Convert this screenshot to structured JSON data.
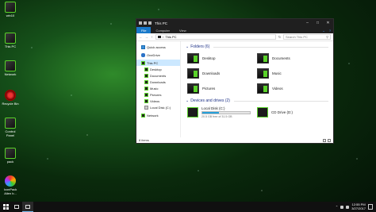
{
  "desktop": {
    "icons": [
      {
        "label": "win10",
        "icon": "win10-icon"
      },
      {
        "label": "This PC",
        "icon": "this-pc-icon"
      },
      {
        "label": "Network",
        "icon": "network-icon"
      },
      {
        "label": "Recycle Bin",
        "icon": "recycle-bin-icon"
      },
      {
        "label": "Control Panel",
        "icon": "control-panel-icon"
      },
      {
        "label": "pack",
        "icon": "pack-icon"
      },
      {
        "label": "IconPack Alien b...",
        "icon": "iconpack-icon"
      }
    ]
  },
  "window": {
    "title": "This PC",
    "ribbon_tabs": [
      "File",
      "Computer",
      "View"
    ],
    "address_path": "This PC",
    "search_placeholder": "Search This PC",
    "nav_pane": [
      {
        "label": "Quick access",
        "icon": "star-icon"
      },
      {
        "label": "OneDrive",
        "icon": "onedrive-icon"
      },
      {
        "label": "This PC",
        "icon": "this-pc-icon"
      },
      {
        "label": "Desktop",
        "icon": "desktop-folder-icon"
      },
      {
        "label": "Documents",
        "icon": "documents-folder-icon"
      },
      {
        "label": "Downloads",
        "icon": "downloads-folder-icon"
      },
      {
        "label": "Music",
        "icon": "music-folder-icon"
      },
      {
        "label": "Pictures",
        "icon": "pictures-folder-icon"
      },
      {
        "label": "Videos",
        "icon": "videos-folder-icon"
      },
      {
        "label": "Local Disk (C:)",
        "icon": "local-disk-icon"
      },
      {
        "label": "Network",
        "icon": "network-icon"
      }
    ],
    "folders_header": "Folders (6)",
    "folders": [
      "Desktop",
      "Documents",
      "Downloads",
      "Music",
      "Pictures",
      "Videos"
    ],
    "drives_header": "Devices and drives (2)",
    "drives": [
      {
        "label": "Local Disk (C:)",
        "free_text": "20.5 GB free of 31.5 GB",
        "used_fraction": 0.35
      },
      {
        "label": "CD Drive (D:)"
      }
    ],
    "status": "8 items"
  },
  "taskbar": {
    "time": "12:55 PM",
    "date": "3/27/2017"
  },
  "colors": {
    "accent": "#1979ca",
    "theme_green": "#5ad22a",
    "disk_bar": "#26a0da"
  }
}
